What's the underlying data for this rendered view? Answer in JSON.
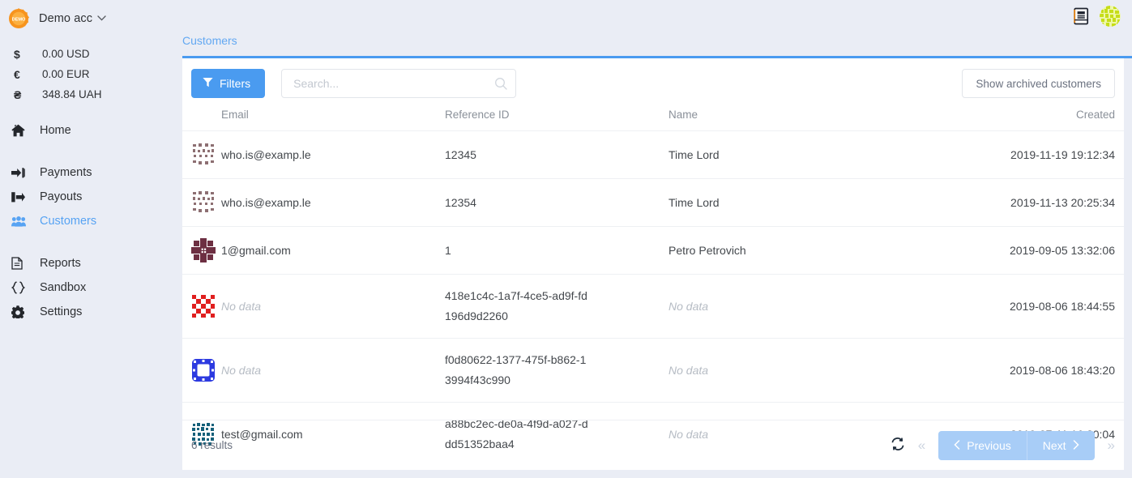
{
  "sidebar": {
    "account": {
      "name": "Demo acc",
      "logo_text": "DEMO",
      "caret": "chevron-down"
    },
    "balances": [
      {
        "symbol": "$",
        "amount": "0.00 USD"
      },
      {
        "symbol": "€",
        "amount": "0.00 EUR"
      },
      {
        "symbol": "₴",
        "amount": "348.84 UAH"
      }
    ],
    "groups": [
      {
        "items": [
          {
            "label": "Home",
            "icon": "home-icon",
            "active": false
          }
        ]
      },
      {
        "items": [
          {
            "label": "Payments",
            "icon": "sign-in-icon",
            "active": false
          },
          {
            "label": "Payouts",
            "icon": "sign-out-icon",
            "active": false
          },
          {
            "label": "Customers",
            "icon": "users-icon",
            "active": true
          }
        ]
      },
      {
        "items": [
          {
            "label": "Reports",
            "icon": "document-icon",
            "active": false
          },
          {
            "label": "Sandbox",
            "icon": "code-braces-icon",
            "active": false
          },
          {
            "label": "Settings",
            "icon": "gear-icon",
            "active": false
          }
        ]
      }
    ]
  },
  "topbar": {
    "docs_icon": "book-icon",
    "user_avatar": "user-identicon-avatar"
  },
  "tabs": [
    {
      "label": "Customers",
      "active": true
    }
  ],
  "toolbar": {
    "filters_label": "Filters",
    "filters_icon": "funnel-icon",
    "search_value": "",
    "search_placeholder": "Search...",
    "search_icon": "search-icon",
    "archived_label": "Show archived customers"
  },
  "table": {
    "columns": [
      {
        "key": "avatar",
        "label": ""
      },
      {
        "key": "email",
        "label": "Email"
      },
      {
        "key": "reference_id",
        "label": "Reference ID"
      },
      {
        "key": "name",
        "label": "Name"
      },
      {
        "key": "created",
        "label": "Created"
      }
    ],
    "rows": [
      {
        "avatar": "identicon-brown-1",
        "email": "who.is@examp.le",
        "email_empty": false,
        "reference_id": "12345",
        "name": "Time Lord",
        "name_empty": false,
        "created": "2019-11-19 19:12:34"
      },
      {
        "avatar": "identicon-brown-1",
        "email": "who.is@examp.le",
        "email_empty": false,
        "reference_id": "12354",
        "name": "Time Lord",
        "name_empty": false,
        "created": "2019-11-13 20:25:34"
      },
      {
        "avatar": "identicon-maroon",
        "email": "1@gmail.com",
        "email_empty": false,
        "reference_id": "1",
        "name": "Petro Petrovich",
        "name_empty": false,
        "created": "2019-09-05 13:32:06"
      },
      {
        "avatar": "identicon-red",
        "email": "No data",
        "email_empty": true,
        "reference_id": "418e1c4c-1a7f-4ce5-ad9f-fd196d9d2260",
        "name": "No data",
        "name_empty": true,
        "created": "2019-08-06 18:44:55"
      },
      {
        "avatar": "identicon-blue",
        "email": "No data",
        "email_empty": true,
        "reference_id": "f0d80622-1377-475f-b862-13994f43c990",
        "name": "No data",
        "name_empty": true,
        "created": "2019-08-06 18:43:20"
      },
      {
        "avatar": "identicon-teal",
        "email": "test@gmail.com",
        "email_empty": false,
        "reference_id": "a88bc2ec-de0a-4f9d-a027-ddd51352baa4",
        "name": "No data",
        "name_empty": true,
        "created": "2019-07-11 16:20:04"
      }
    ]
  },
  "footer": {
    "results": "6 results",
    "refresh_icon": "refresh-icon",
    "first_label": "«",
    "last_label": "»",
    "previous_label": "Previous",
    "next_label": "Next"
  },
  "colors": {
    "accent": "#4a9bf0",
    "accent_muted": "#a8cdf7",
    "page_bg": "#eaedf5",
    "card_bg": "#ffffff",
    "text": "#44484d",
    "muted": "#8a9099",
    "placeholder": "#b6bcc4"
  }
}
